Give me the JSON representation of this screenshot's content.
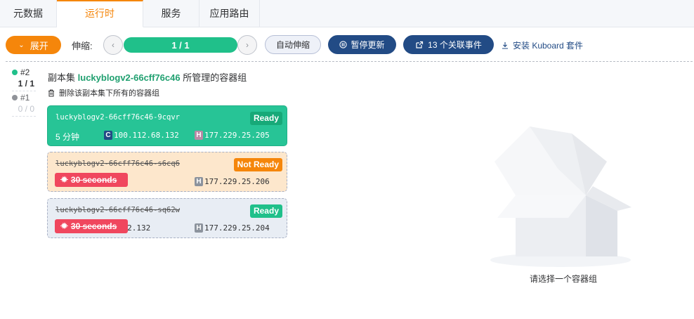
{
  "tabs": [
    {
      "label": "元数据"
    },
    {
      "label": "运行时"
    },
    {
      "label": "服务"
    },
    {
      "label": "应用路由"
    }
  ],
  "toolbar": {
    "expand_label": "展开",
    "scale_label": "伸缩:",
    "replica_count": "1 / 1",
    "autoscale_label": "自动伸缩",
    "pause_label": "暂停更新",
    "events_label": "13 个关联事件",
    "install_label": "安装 Kuboard 套件"
  },
  "revisions": [
    {
      "label": "#2",
      "count": "1 / 1",
      "color": "#20c08a"
    },
    {
      "label": "#1",
      "count": "0 / 0",
      "color": "#909399"
    }
  ],
  "replicaset": {
    "prefix": "副本集",
    "name": "luckyblogv2-66cff76c46",
    "suffix": "所管理的容器组",
    "delete_label": "删除该副本集下所有的容器组"
  },
  "pods": [
    {
      "name": "luckyblogv2-66cff76c46-9cqvr",
      "status": "Ready",
      "age": "5 分钟",
      "pod_ip_tag": "C",
      "pod_ip": "100.112.68.132",
      "host_ip_tag": "H",
      "host_ip": "177.229.25.205"
    },
    {
      "name": "luckyblogv2-66cff76c46-s6cq6",
      "status": "Not Ready",
      "terminating": "30 seconds",
      "host_ip_tag": "H",
      "host_ip": "177.229.25.206"
    },
    {
      "name": "luckyblogv2-66cff76c46-sq62w",
      "status": "Ready",
      "terminating": "30 seconds",
      "pod_ip": ".86.32.132",
      "host_ip_tag": "H",
      "host_ip": "177.229.25.204"
    }
  ],
  "empty_state": {
    "label": "请选择一个容器组"
  },
  "colors": {
    "accent": "#f5860b",
    "primary": "#224b85",
    "success": "#20c08a",
    "danger": "#f0475e"
  }
}
